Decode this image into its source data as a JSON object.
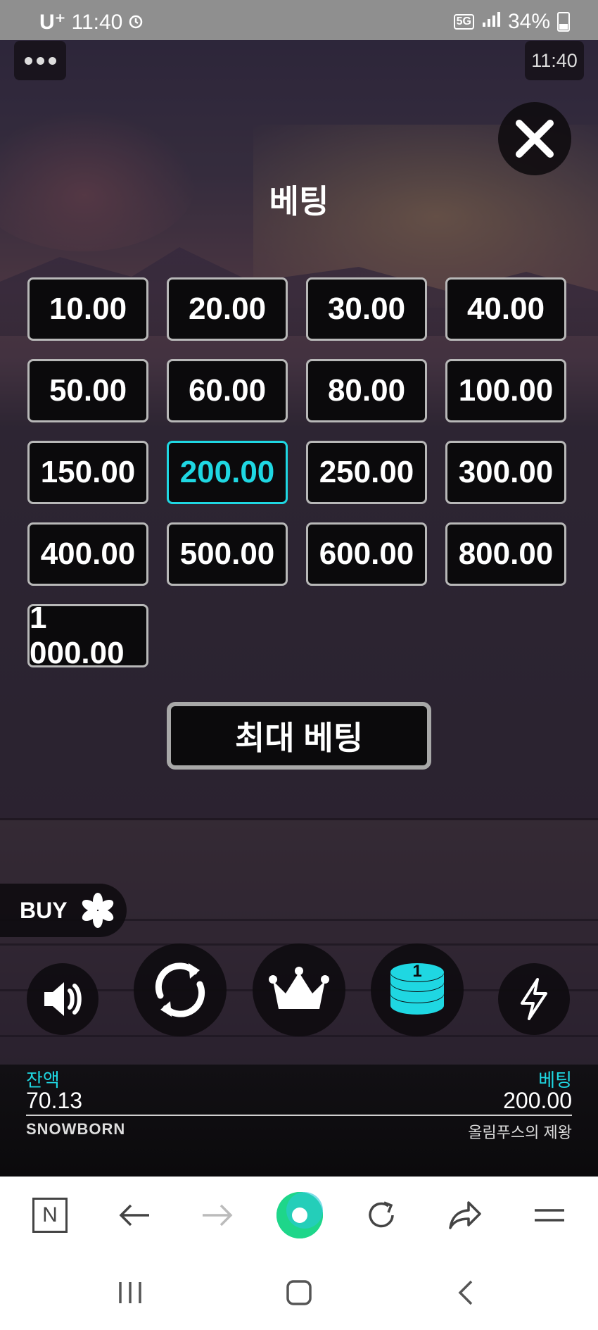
{
  "status": {
    "carrier": "U⁺",
    "time": "11:40",
    "network": "5G",
    "battery": "34%"
  },
  "game": {
    "clock": "11:40",
    "title": "베팅",
    "bet_options": [
      {
        "label": "10.00",
        "selected": false
      },
      {
        "label": "20.00",
        "selected": false
      },
      {
        "label": "30.00",
        "selected": false
      },
      {
        "label": "40.00",
        "selected": false
      },
      {
        "label": "50.00",
        "selected": false
      },
      {
        "label": "60.00",
        "selected": false
      },
      {
        "label": "80.00",
        "selected": false
      },
      {
        "label": "100.00",
        "selected": false
      },
      {
        "label": "150.00",
        "selected": false
      },
      {
        "label": "200.00",
        "selected": true
      },
      {
        "label": "250.00",
        "selected": false
      },
      {
        "label": "300.00",
        "selected": false
      },
      {
        "label": "400.00",
        "selected": false
      },
      {
        "label": "500.00",
        "selected": false
      },
      {
        "label": "600.00",
        "selected": false
      },
      {
        "label": "800.00",
        "selected": false
      },
      {
        "label": "1 000.00",
        "selected": false
      }
    ],
    "max_bet_label": "최대 베팅",
    "buy_label": "BUY",
    "coin_badge": "1",
    "balance_label": "잔액",
    "balance_value": "70.13",
    "bet_label": "베팅",
    "bet_value": "200.00",
    "brand": "SNOWBORN",
    "game_name": "올림푸스의 제왕"
  },
  "browser": {
    "home_icon_text": "N"
  },
  "colors": {
    "accent": "#1fd7e2",
    "button_bg": "#0b0a0c",
    "browser_green": "#1ed68a"
  }
}
